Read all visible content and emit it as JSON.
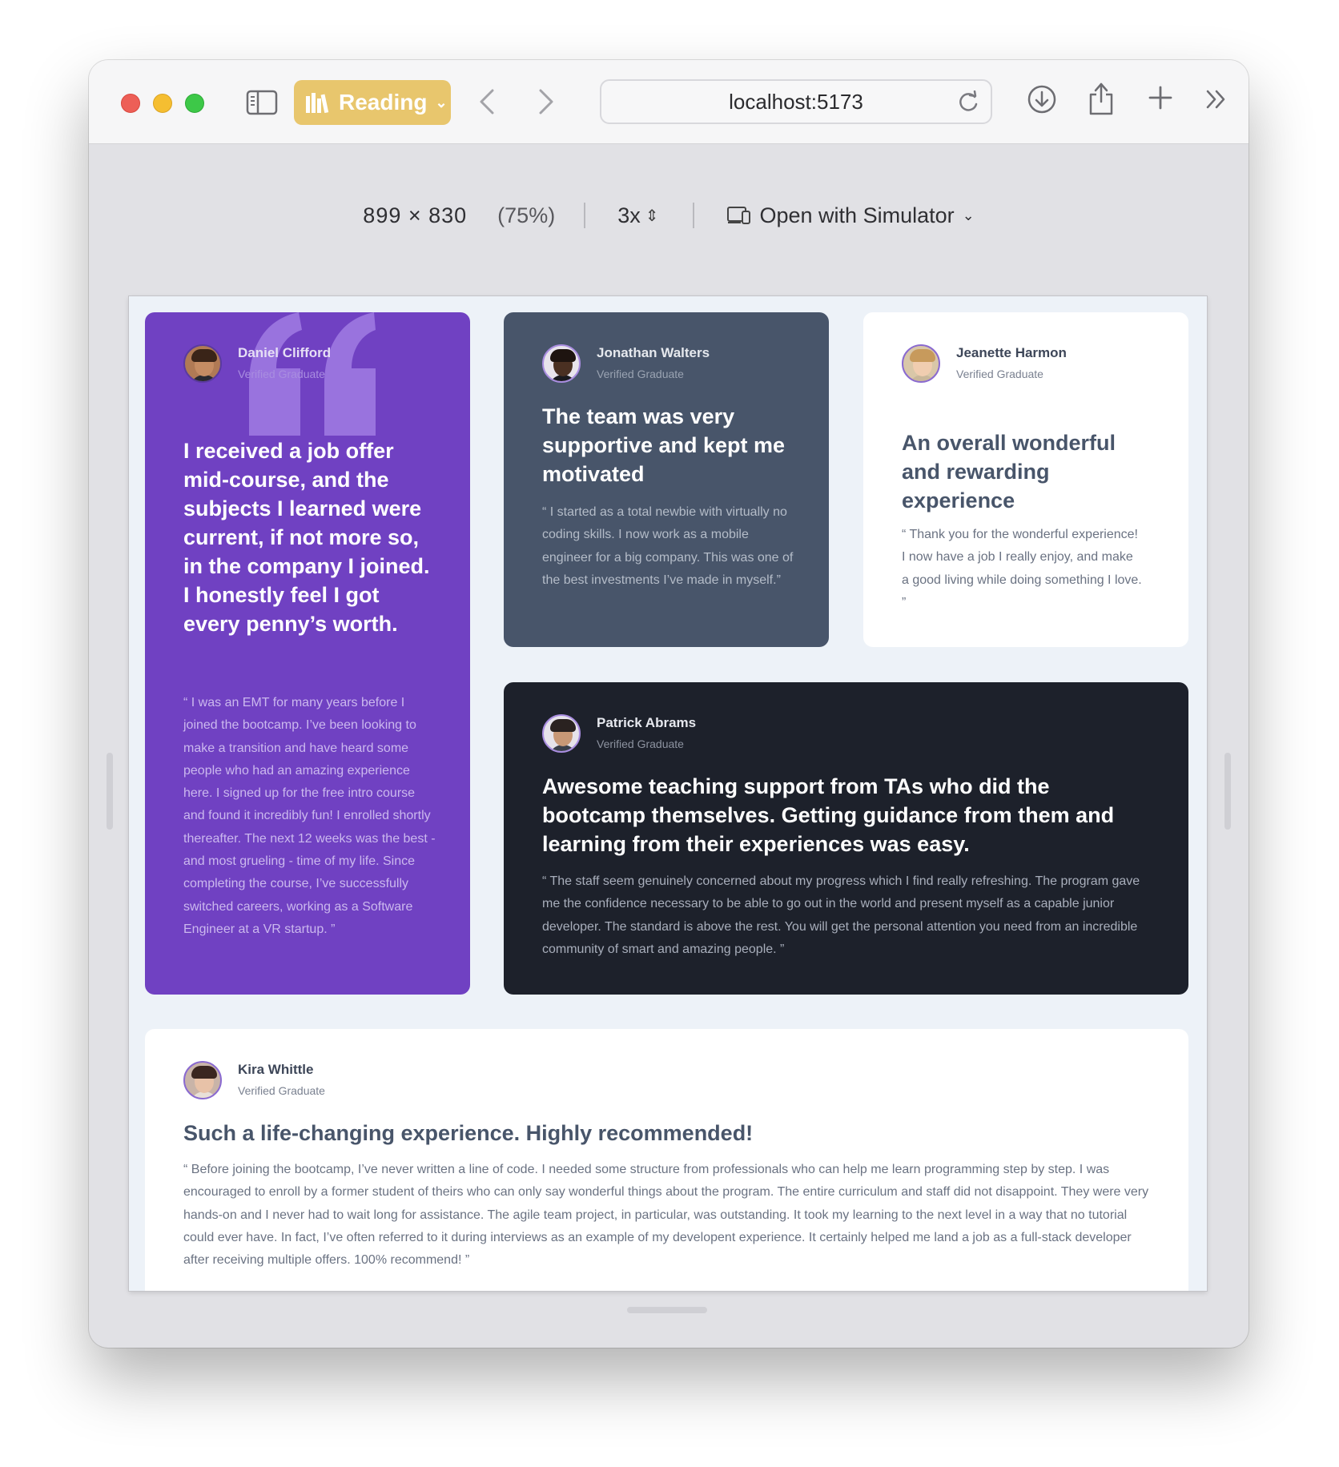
{
  "browser": {
    "reading_label": "Reading",
    "url": "localhost:5173",
    "device": {
      "dimensions": "899 × 830",
      "zoom": "(75%)",
      "scale": "3x",
      "simulator_label": "Open with Simulator"
    }
  },
  "colors": {
    "purple": "#7041c2",
    "slate": "#48556a",
    "dark": "#1d212b",
    "white": "#ffffff",
    "background": "#edf2f8",
    "reading_button": "#e8c66d"
  },
  "testimonials": [
    {
      "name": "Daniel Clifford",
      "role": "Verified Graduate",
      "headline": "I received a job offer mid-course, and the subjects I learned were current, if not more so, in the company I joined. I honestly feel I got every penny’s worth.",
      "quote": "“ I was an EMT for many years before I joined the bootcamp. I’ve been looking to make a transition and have heard some people who had an amazing experience here. I signed up for the free intro course and found it incredibly fun! I enrolled shortly thereafter. The next 12 weeks was the best - and most grueling - time of my life. Since completing the course, I’ve successfully switched careers, working as a Software Engineer at a VR startup. ”"
    },
    {
      "name": "Jonathan Walters",
      "role": "Verified Graduate",
      "headline": "The team was very supportive and kept me motivated",
      "quote": "“ I started as a total newbie with virtually no coding skills. I now work as a mobile engineer for a big company. This was one of the best investments I’ve made in myself.”"
    },
    {
      "name": "Jeanette Harmon",
      "role": "Verified Graduate",
      "headline": "An overall wonderful and rewarding experience",
      "quote": "“ Thank you for the wonderful experience! I now have a job I really enjoy, and make a good living while doing something I love. ”"
    },
    {
      "name": "Patrick Abrams",
      "role": "Verified Graduate",
      "headline": "Awesome teaching support from TAs who did the bootcamp themselves. Getting guidance from them and learning from their experiences was easy.",
      "quote": "“ The staff seem genuinely concerned about my progress which I find really refreshing. The program gave me the confidence necessary to be able to go out in the world and present myself as a capable junior developer. The standard is above the rest. You will get the personal attention you need from an incredible community of smart and amazing people. ”"
    },
    {
      "name": "Kira Whittle",
      "role": "Verified Graduate",
      "headline": "Such a life-changing experience. Highly recommended!",
      "quote": "“ Before joining the bootcamp, I’ve never written a line of code. I needed some structure from professionals who can help me learn programming step by step. I was encouraged to enroll by a former student of theirs who can only say wonderful things about the program. The entire curriculum and staff did not disappoint. They were very hands-on and I never had to wait long for assistance. The agile team project, in particular, was outstanding. It took my learning to the next level in a way that no tutorial could ever have. In fact, I’ve often referred to it during interviews as an example of my developent experience. It certainly helped me land a job as a full-stack developer after receiving multiple offers. 100% recommend! ”"
    }
  ]
}
